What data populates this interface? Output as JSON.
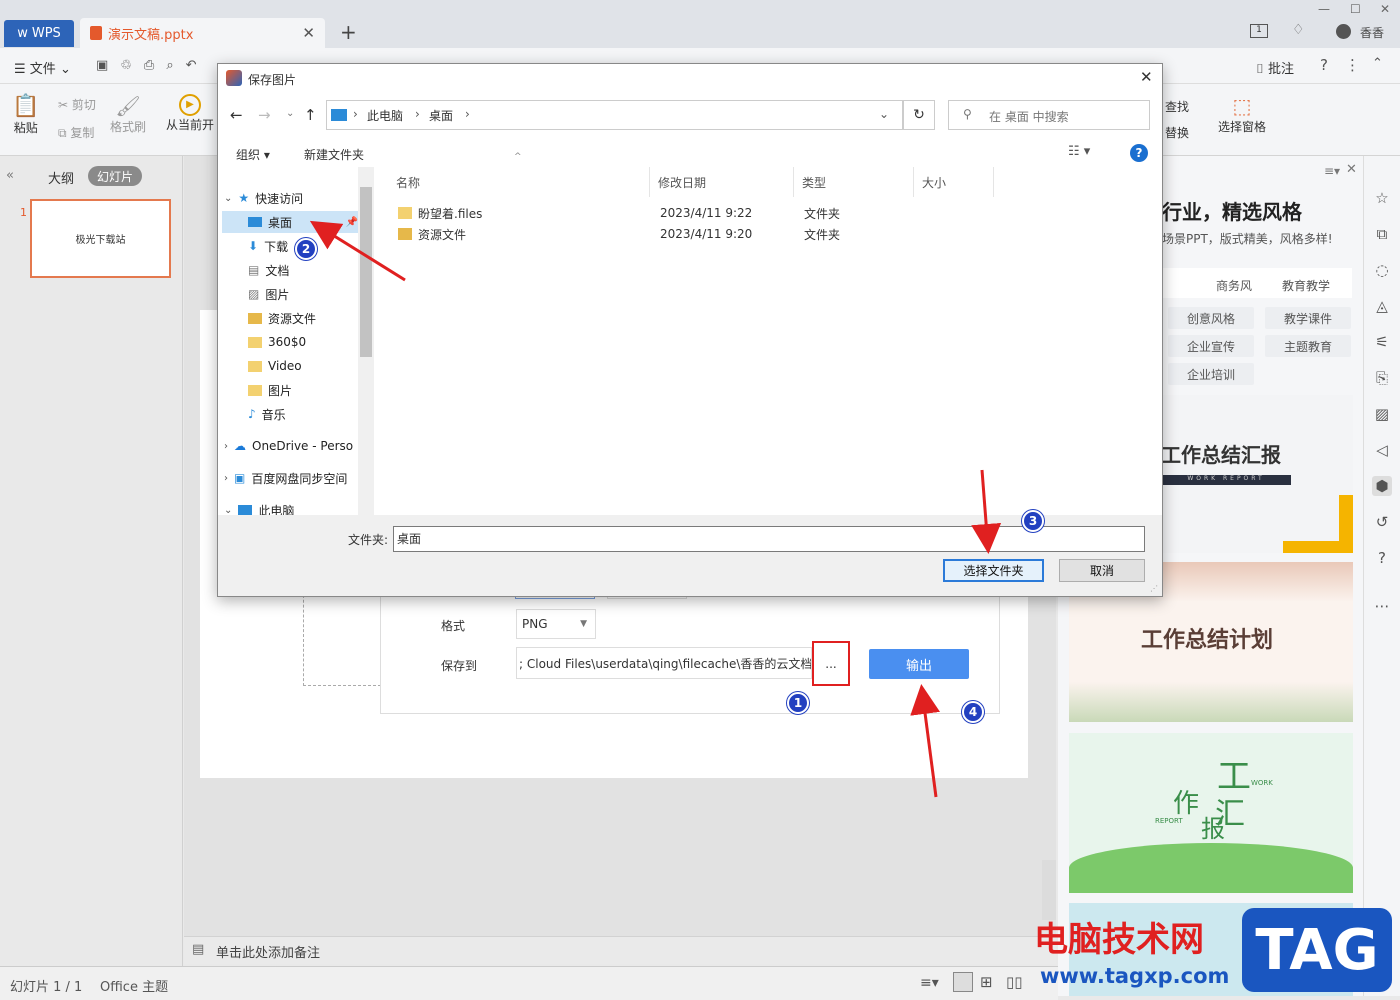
{
  "app": {
    "wps_label": "WPS",
    "doc_tab": "演示文稿.pptx",
    "user": "香香"
  },
  "menu": {
    "file": "文件",
    "review": "批注"
  },
  "ribbon": {
    "paste": "粘贴",
    "cut": "剪切",
    "copy": "复制",
    "format_painter": "格式刷",
    "from_current": "从当前开",
    "find": "查找",
    "replace": "替换",
    "select_pane": "选择窗格"
  },
  "left": {
    "outline_tab": "大纲",
    "slides_tab": "幻灯片",
    "slide_num": "1",
    "thumb_text": "极光下载站"
  },
  "notes": {
    "placeholder": "单击此处添加备注"
  },
  "status": {
    "slide_info": "幻灯片 1 / 1",
    "theme": "Office 主题"
  },
  "export": {
    "format_label": "格式",
    "format_value": "PNG",
    "save_to_label": "保存到",
    "save_path": "; Cloud Files\\userdata\\qing\\filecache\\香香的云文档\\",
    "browse": "...",
    "output": "输出"
  },
  "dialog": {
    "title": "保存图片",
    "crumb": [
      "此电脑",
      "桌面"
    ],
    "search_placeholder": "在 桌面 中搜索",
    "organize": "组织 ▾",
    "new_folder": "新建文件夹",
    "nav": {
      "quick": "快速访问",
      "desktop": "桌面",
      "downloads": "下载",
      "docs": "文档",
      "pictures": "图片",
      "resources": "资源文件",
      "f360": "360$0",
      "video": "Video",
      "pics2": "图片",
      "music": "音乐",
      "onedrive": "OneDrive - Perso",
      "baidu": "百度网盘同步空间",
      "pc": "此电脑"
    },
    "columns": {
      "name": "名称",
      "date": "修改日期",
      "type": "类型",
      "size": "大小"
    },
    "files": [
      {
        "name": "盼望着.files",
        "date": "2023/4/11 9:22",
        "type": "文件夹"
      },
      {
        "name": "资源文件",
        "date": "2023/4/11 9:20",
        "type": "文件夹"
      }
    ],
    "folder_label": "文件夹:",
    "folder_value": "桌面",
    "select_btn": "选择文件夹",
    "cancel_btn": "取消"
  },
  "right": {
    "headline": "行业，精选风格",
    "sub": "场景PPT，版式精美，风格多样!",
    "tags": [
      "商务风",
      "教育教学",
      "创意风格",
      "教学课件",
      "企业宣传",
      "主题教育",
      "企业培训"
    ],
    "tmpl1": "工作总结汇报",
    "tmpl1_sub": "WORK REPORT",
    "tmpl2": "工作总结计划",
    "tmpl3_big": "工",
    "tmpl3_a": "作",
    "tmpl3_b": "汇",
    "tmpl3_c": "报",
    "tmpl3_work": "WORK",
    "tmpl3_report": "REPORT"
  },
  "badges": [
    "1",
    "2",
    "3",
    "4"
  ],
  "watermark": {
    "text": "电脑技术网",
    "url": "www.tagxp.com",
    "logo": "TAG"
  }
}
